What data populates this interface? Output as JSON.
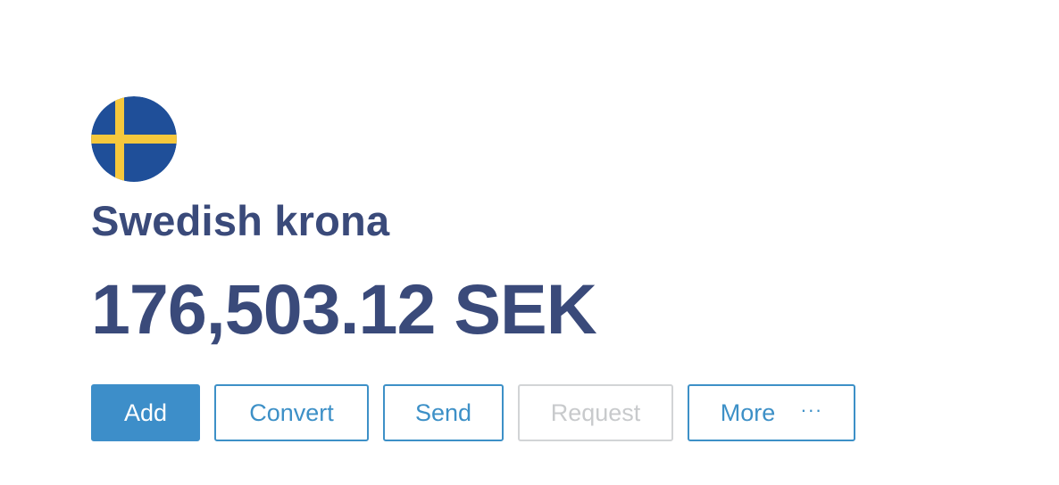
{
  "account": {
    "currency_name": "Swedish krona",
    "balance": "176,503.12 SEK",
    "flag_icon": "sweden-flag-icon"
  },
  "actions": {
    "add_label": "Add",
    "convert_label": "Convert",
    "send_label": "Send",
    "request_label": "Request",
    "more_label": "More",
    "more_icon": "···"
  },
  "colors": {
    "heading_text": "#3a4a7a",
    "primary": "#3d8ec9",
    "disabled": "#d2d4d6",
    "flag_blue": "#1f4f99",
    "flag_yellow": "#f6c83c"
  }
}
